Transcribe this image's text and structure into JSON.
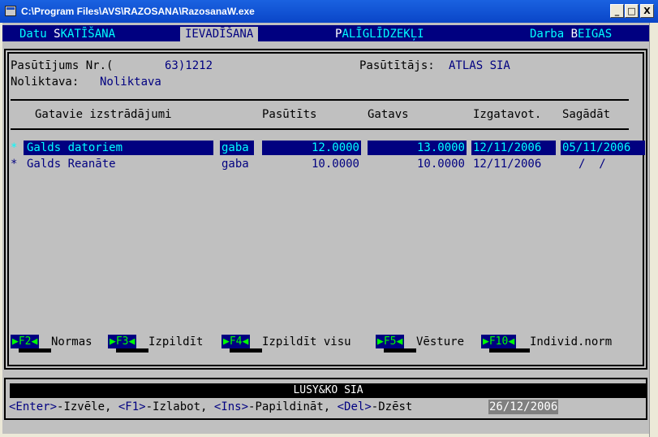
{
  "window": {
    "title": "C:\\Program Files\\AVS\\RAZOSANA\\RazosanaW.exe",
    "min": "_",
    "max": "□",
    "close": "X"
  },
  "menu": [
    {
      "pre": "Datu ",
      "hk": "S",
      "post": "KATĪŠANA"
    },
    {
      "pre": "",
      "hk": "",
      "post": "IEVADĪŠANA"
    },
    {
      "pre": "",
      "hk": "P",
      "post": "ALĪGLĪDZEKĻI"
    },
    {
      "pre": "Darba ",
      "hk": "B",
      "post": "EIGAS"
    }
  ],
  "order": {
    "label_nr": "Pasūtījums Nr.(",
    "nr_value": "63)1212",
    "label_customer": "Pasūtītājs:",
    "customer": "ATLAS SIA",
    "label_warehouse": "Noliktava:",
    "warehouse": "Noliktava"
  },
  "columns": [
    "Gatavie izstrādājumi",
    "Pasūtīts",
    "Gatavs",
    "Izgatavot.",
    "Sagādāt"
  ],
  "rows": [
    {
      "mark": "*",
      "name": "Galds datoriem",
      "unit": "gaba",
      "ordered": "12.0000",
      "ready": "13.0000",
      "make_date": "12/11/2006",
      "supply_date": "05/11/2006",
      "selected": true
    },
    {
      "mark": "*",
      "name": "Galds Reanāte",
      "unit": "gaba",
      "ordered": "10.0000",
      "ready": "10.0000",
      "make_date": "12/11/2006",
      "supply_date": "/  /",
      "selected": false
    }
  ],
  "fkeys": [
    {
      "key": "F2",
      "label": "Normas"
    },
    {
      "key": "F3",
      "label": "Izpildīt"
    },
    {
      "key": "F4",
      "label": "Izpildīt visu"
    },
    {
      "key": "F5",
      "label": "Vēsture"
    },
    {
      "key": "F10",
      "label": "Individ.norm"
    }
  ],
  "company": "LUSY&KO SIA",
  "hints": {
    "enter_key": "<Enter>",
    "enter_text": "-Izvēle, ",
    "f1_key": "<F1>",
    "f1_text": "-Izlabot, ",
    "ins_key": "<Ins>",
    "ins_text": "-Papildināt, ",
    "del_key": "<Del>",
    "del_text": "-Dzēst"
  },
  "date": "26/12/2006"
}
